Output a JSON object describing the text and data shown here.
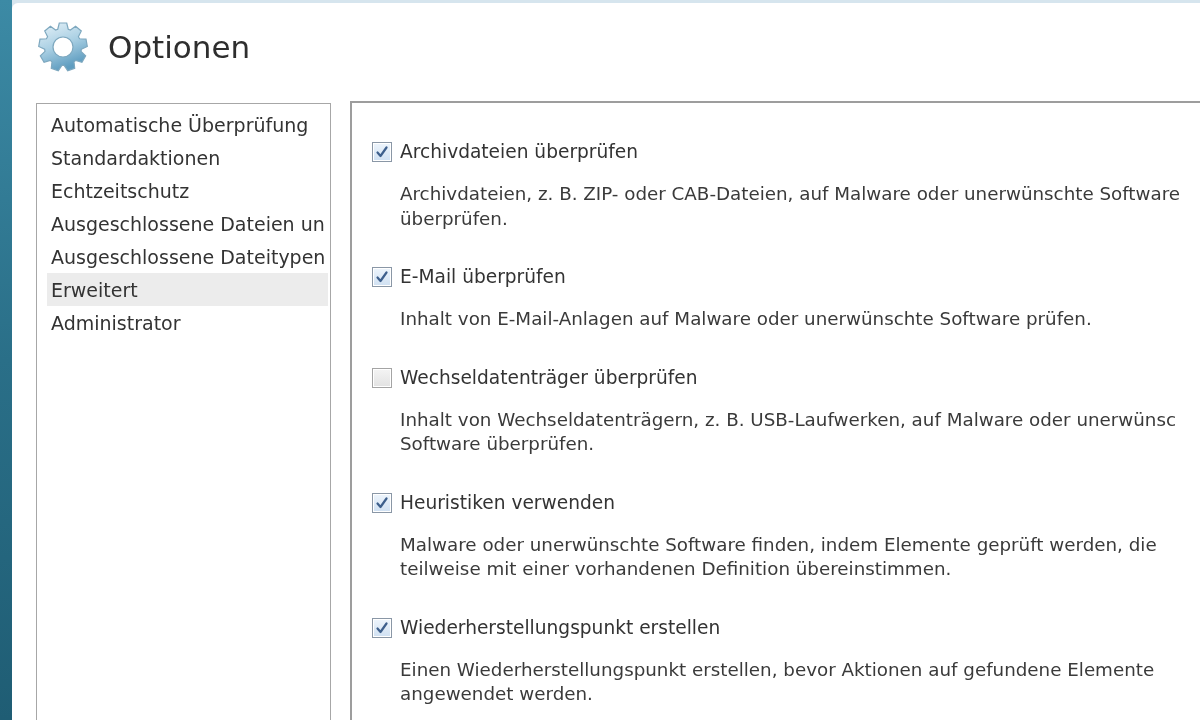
{
  "window": {
    "title": "Optionen"
  },
  "sidebar": {
    "items": [
      {
        "label": "Automatische Überprüfung",
        "selected": false
      },
      {
        "label": "Standardaktionen",
        "selected": false
      },
      {
        "label": "Echtzeitschutz",
        "selected": false
      },
      {
        "label": "Ausgeschlossene Dateien un",
        "selected": false
      },
      {
        "label": "Ausgeschlossene Dateitypen",
        "selected": false
      },
      {
        "label": "Erweitert",
        "selected": true
      },
      {
        "label": "Administrator",
        "selected": false
      }
    ]
  },
  "options": [
    {
      "label": "Archivdateien überprüfen",
      "checked": true,
      "description": [
        "Archivdateien, z. B. ZIP- oder CAB-Dateien, auf Malware oder unerwünschte Software",
        "überprüfen."
      ]
    },
    {
      "label": "E-Mail überprüfen",
      "checked": true,
      "description": [
        "Inhalt von E-Mail-Anlagen auf Malware oder unerwünschte Software prüfen."
      ]
    },
    {
      "label": "Wechseldatenträger überprüfen",
      "checked": false,
      "description": [
        "Inhalt von Wechseldatenträgern, z. B. USB-Laufwerken, auf Malware oder unerwünsc",
        "Software überprüfen."
      ]
    },
    {
      "label": "Heuristiken verwenden",
      "checked": true,
      "description": [
        "Malware oder unerwünschte Software finden, indem Elemente geprüft werden, die",
        "teilweise mit einer vorhandenen Definition übereinstimmen."
      ]
    },
    {
      "label": "Wiederherstellungspunkt erstellen",
      "checked": true,
      "description": [
        "Einen Wiederherstellungspunkt erstellen, bevor Aktionen auf gefundene Elemente",
        "angewendet werden."
      ]
    }
  ]
}
